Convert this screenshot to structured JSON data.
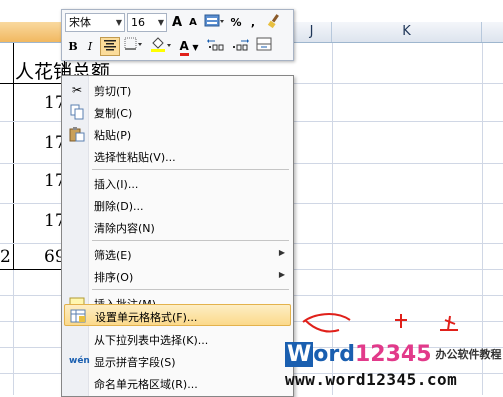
{
  "spreadsheet": {
    "columns": [
      {
        "id": "first",
        "label": ""
      },
      {
        "id": "j",
        "label": "J"
      },
      {
        "id": "k",
        "label": "K"
      }
    ],
    "cells": {
      "header": "人花销总额",
      "values": [
        "17",
        "17",
        "17",
        "17",
        "69"
      ],
      "left_digit": "2"
    }
  },
  "mini_toolbar": {
    "font_name": "宋体",
    "font_size": "16",
    "grow_font": "A",
    "shrink_font": "A",
    "percent": "%",
    "comma": ",",
    "bold": "B",
    "italic": "I",
    "font_color_letter": "A",
    "increase_decimal": ".0→.00",
    "decrease_decimal": ".00→.0"
  },
  "context_menu": {
    "items": [
      {
        "label": "剪切(T)",
        "icon": "scissors-icon"
      },
      {
        "label": "复制(C)",
        "icon": "copy-icon"
      },
      {
        "label": "粘贴(P)",
        "icon": "paste-icon"
      },
      {
        "label": "选择性粘贴(V)...",
        "icon": ""
      },
      {
        "label": "插入(I)...",
        "icon": ""
      },
      {
        "label": "删除(D)...",
        "icon": ""
      },
      {
        "label": "清除内容(N)",
        "icon": ""
      },
      {
        "label": "筛选(E)",
        "icon": "",
        "submenu": true
      },
      {
        "label": "排序(O)",
        "icon": "",
        "submenu": true
      },
      {
        "label": "插入批注(M)",
        "icon": "comment-icon"
      },
      {
        "label": "设置单元格格式(F)...",
        "icon": "format-cells-icon",
        "highlighted": true
      },
      {
        "label": "从下拉列表中选择(K)...",
        "icon": ""
      },
      {
        "label": "显示拼音字段(S)",
        "icon": "phonetic-icon"
      },
      {
        "label": "命名单元格区域(R)...",
        "icon": ""
      }
    ]
  },
  "watermark": {
    "logo_w": "W",
    "logo_ord": "ord",
    "logo_num": "12345",
    "subtitle": "办公软件教程",
    "url": "www.word12345.com"
  },
  "colors": {
    "menu_highlight": "#fbd98b",
    "annotation_red": "#e0201a",
    "logo_blue": "#1a5fb0",
    "logo_pink": "#e23a8a"
  }
}
